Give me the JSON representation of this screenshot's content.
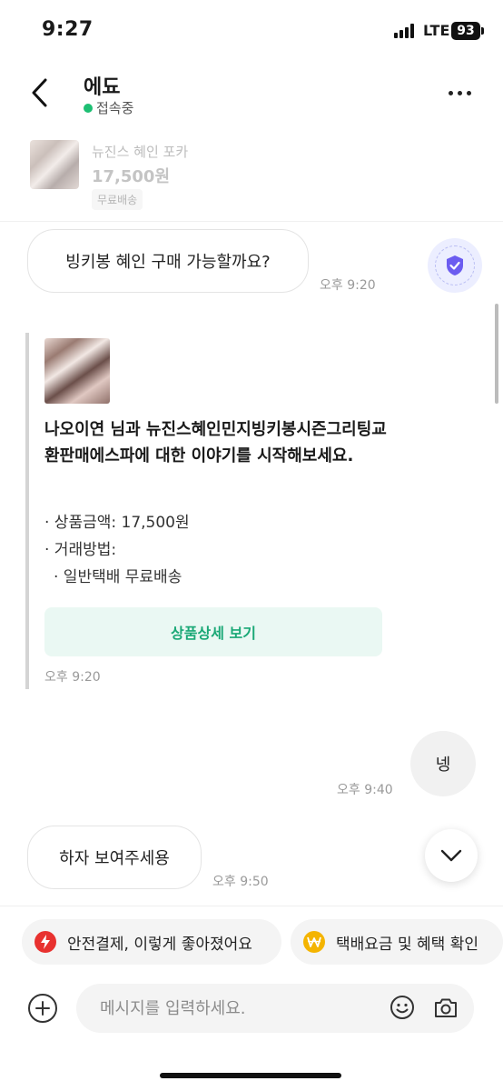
{
  "status_bar": {
    "time": "9:27",
    "network": "LTE",
    "battery": "93"
  },
  "header": {
    "title": "에됴",
    "status": "접속중"
  },
  "product": {
    "name": "뉴진스 혜인 포카",
    "price": "17,500원",
    "badge": "무료배송"
  },
  "messages": [
    {
      "text": "빙키봉 혜인 구매 가능할까요?",
      "time": "오후 9:20"
    },
    {
      "text": "넹",
      "time": "오후 9:40"
    },
    {
      "text": "하자 보여주세용",
      "time": "오후 9:50"
    }
  ],
  "system_card": {
    "text": "나오이연 님과 뉴진스혜인민지빙키봉시즌그리팅교환판매에스파에 대한 이야기를 시작해보세요.",
    "price_line": "· 상품금액: 17,500원",
    "method_line": "· 거래방법:",
    "method_detail": "· 일반택배 무료배송",
    "button": "상품상세 보기",
    "time": "오후 9:20"
  },
  "quick_chips": [
    {
      "label": "안전결제, 이렇게 좋아졌어요",
      "icon": "lightning-icon",
      "color": "#e8312f"
    },
    {
      "label": "택배요금 및 혜택 확인",
      "icon": "won-coin-icon",
      "color": "#f4b400"
    }
  ],
  "input": {
    "placeholder": "메시지를 입력하세요."
  },
  "colors": {
    "online": "#1dbf73",
    "accent_green": "#1aa876",
    "shield": "#6b5cf0"
  }
}
